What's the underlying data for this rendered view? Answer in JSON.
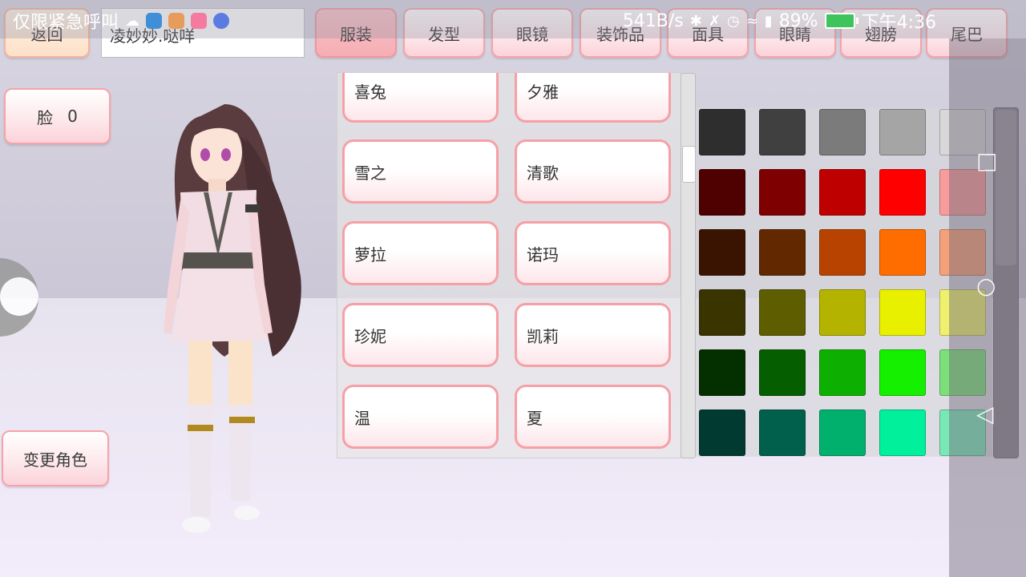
{
  "status_bar": {
    "left_text": "仅限紧急呼叫",
    "net_speed": "541B/s",
    "battery": "89%",
    "time": "下午4:36"
  },
  "top": {
    "back_label": "返回",
    "name_value": "凌妙妙.哒咩"
  },
  "tabs": [
    "服装",
    "发型",
    "眼镜",
    "装饰品",
    "面具",
    "眼睛",
    "翅膀",
    "尾巴"
  ],
  "face": {
    "label": "脸",
    "value": "0"
  },
  "change_character_label": "变更角色",
  "outfits": [
    [
      "喜兔",
      "夕雅"
    ],
    [
      "雪之",
      "清歌"
    ],
    [
      "萝拉",
      "诺玛"
    ],
    [
      "珍妮",
      "凯莉"
    ],
    [
      "温",
      "夏"
    ]
  ],
  "palette": [
    [
      "#2e2e2e",
      "#404040",
      "#7b7b7b",
      "#a5a5a5",
      "#d8d8d8"
    ],
    [
      "#4f0000",
      "#7f0000",
      "#bf0000",
      "#ff0000",
      "#f79b9b"
    ],
    [
      "#3a1400",
      "#622800",
      "#b84300",
      "#ff6c00",
      "#f4a078"
    ],
    [
      "#3a3400",
      "#5e5e00",
      "#b4b400",
      "#e8f000",
      "#eef06e"
    ],
    [
      "#043000",
      "#055f00",
      "#0db000",
      "#14f000",
      "#7ce07a"
    ],
    [
      "#003a30",
      "#00604c",
      "#00b06c",
      "#00f09c",
      "#7ae8b6"
    ]
  ]
}
